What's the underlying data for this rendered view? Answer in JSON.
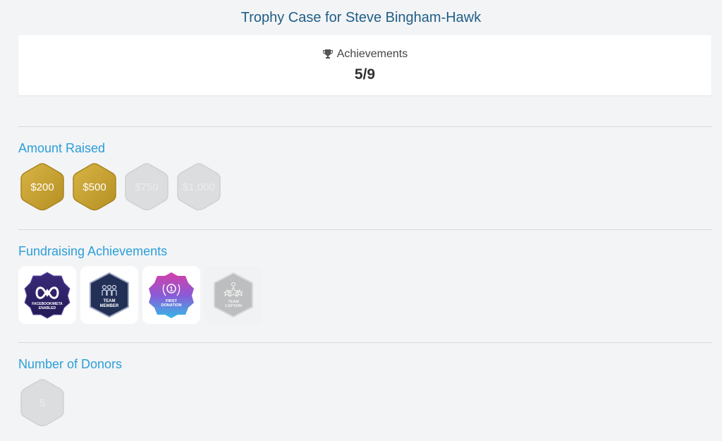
{
  "page": {
    "title": "Trophy Case for Steve Bingham-Hawk"
  },
  "summary": {
    "label": "Achievements",
    "value": "5/9",
    "icon": "trophy-icon"
  },
  "amount_raised": {
    "heading": "Amount Raised",
    "badges": [
      {
        "label": "$200",
        "earned": true
      },
      {
        "label": "$500",
        "earned": true
      },
      {
        "label": "$750",
        "earned": false
      },
      {
        "label": "$1,000",
        "earned": false
      }
    ]
  },
  "fundraising": {
    "heading": "Fundraising Achievements",
    "badges": [
      {
        "line1": "FACEBOOK/META",
        "line2": "ENABLED",
        "earned": true,
        "icon": "meta-infinity-icon"
      },
      {
        "line1": "TEAM",
        "line2": "MEMBER",
        "earned": true,
        "icon": "team-people-icon"
      },
      {
        "number": "1",
        "line1": "FIRST",
        "line2": "DONATION",
        "earned": true,
        "icon": "laurel-icon"
      },
      {
        "line1": "TEAM",
        "line2": "CAPTAIN",
        "earned": false,
        "icon": "captain-stars-icon"
      }
    ]
  },
  "donors": {
    "heading": "Number of Donors",
    "badges": [
      {
        "label": "5",
        "earned": false
      }
    ]
  },
  "colors": {
    "title": "#1f5f86",
    "heading": "#2b9fd8",
    "gold": "#c9a233",
    "locked": "#d9dadb"
  }
}
